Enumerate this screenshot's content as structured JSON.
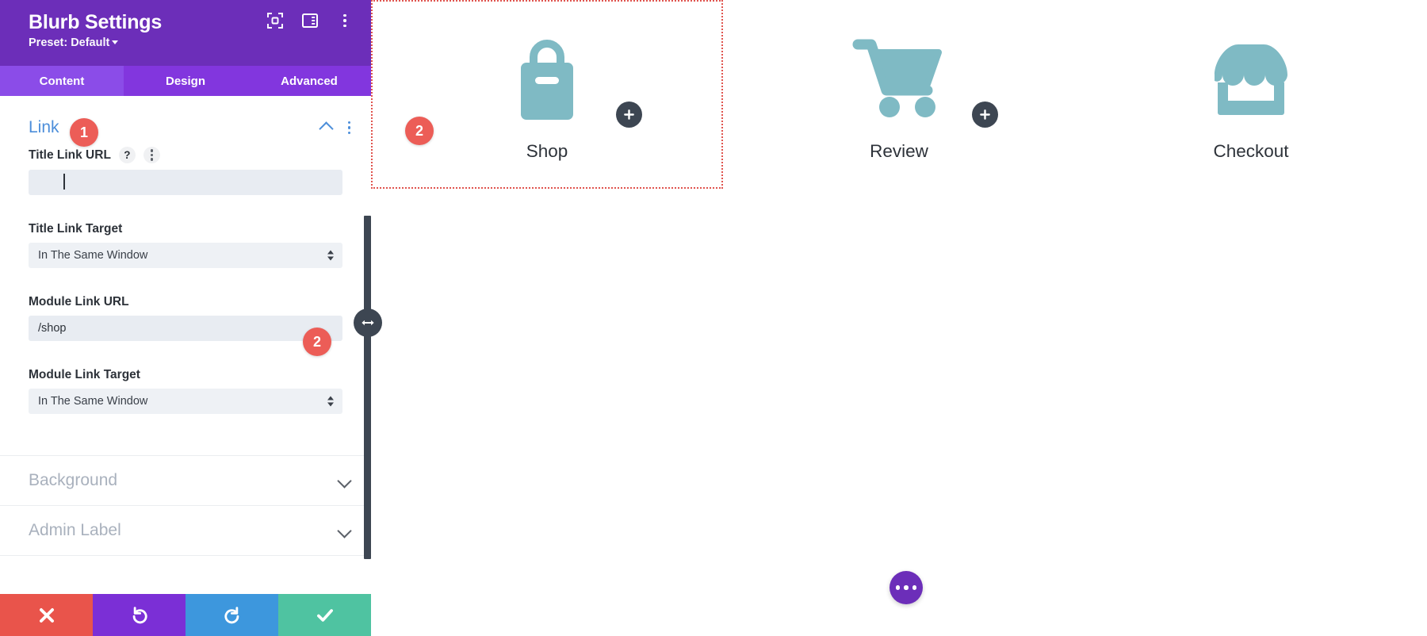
{
  "panel": {
    "title": "Blurb Settings",
    "preset_label": "Preset: Default",
    "header_icons": [
      {
        "name": "focus-frame-icon"
      },
      {
        "name": "layout-panel-icon"
      },
      {
        "name": "kebab-menu-icon"
      }
    ],
    "tabs": [
      {
        "label": "Content",
        "active": true
      },
      {
        "label": "Design",
        "active": false
      },
      {
        "label": "Advanced",
        "active": false
      }
    ],
    "link_section": {
      "title": "Link",
      "badge": "1",
      "fields": {
        "title_link_url": {
          "label": "Title Link URL",
          "value": "",
          "placeholder": "",
          "help_glyph": "?"
        },
        "title_link_target": {
          "label": "Title Link Target",
          "value": "In The Same Window"
        },
        "module_link_url": {
          "label": "Module Link URL",
          "value": "/shop",
          "badge": "2"
        },
        "module_link_target": {
          "label": "Module Link Target",
          "value": "In The Same Window"
        }
      }
    },
    "collapsed_sections": [
      {
        "title": "Background"
      },
      {
        "title": "Admin Label"
      }
    ],
    "action_bar": [
      {
        "name": "cancel-button",
        "icon": "close-icon",
        "color": "#e9544b"
      },
      {
        "name": "undo-button",
        "icon": "undo-icon",
        "color": "#7B2FD6"
      },
      {
        "name": "redo-button",
        "icon": "redo-icon",
        "color": "#3D97DD"
      },
      {
        "name": "save-button",
        "icon": "check-icon",
        "color": "#4FC3A1"
      }
    ]
  },
  "canvas": {
    "badge": "2",
    "modules": [
      {
        "label": "Shop",
        "icon": "shopping-bag-icon",
        "selected": true
      },
      {
        "label": "Review",
        "icon": "shopping-cart-icon",
        "selected": false
      },
      {
        "label": "Checkout",
        "icon": "storefront-icon",
        "selected": false
      }
    ],
    "add_buttons": [
      {
        "name": "add-module-button-1",
        "glyph": "+"
      },
      {
        "name": "add-module-button-2",
        "glyph": "+"
      }
    ],
    "fab": {
      "name": "page-settings-fab",
      "icon": "ellipsis-icon"
    }
  },
  "colors": {
    "brand_purple": "#6C2EB9",
    "tab_purple": "#8236DE",
    "accent_blue": "#4C8EDA",
    "badge_red": "#ec5d57",
    "icon_teal": "#7FBAC4",
    "selection_red": "#e0544e",
    "dark_slate": "#3d4652"
  }
}
